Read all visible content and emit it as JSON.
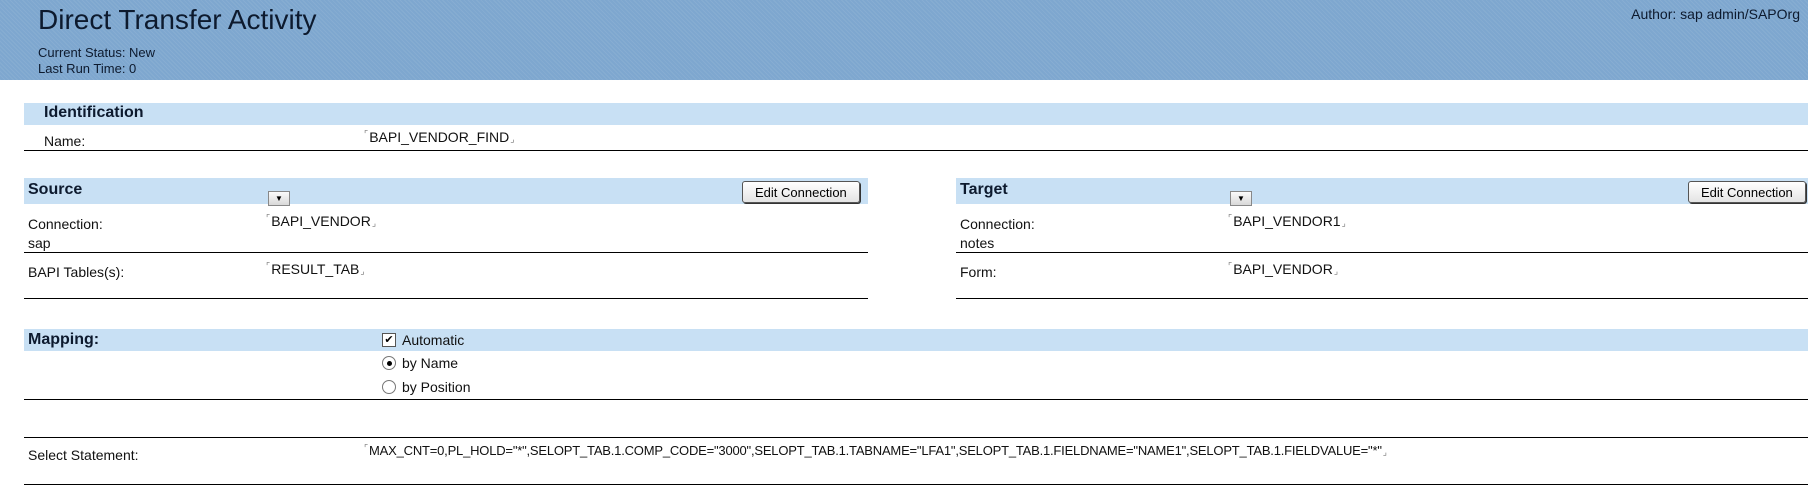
{
  "header": {
    "title": "Direct Transfer Activity",
    "current_status": "Current Status: New",
    "last_run": "Last Run Time:  0",
    "author": "Author: sap admin/SAPOrg"
  },
  "identification": {
    "heading": "Identification",
    "name_label": "Name:",
    "name_value": "BAPI_VENDOR_FIND"
  },
  "source": {
    "heading": "Source",
    "edit_button": "Edit Connection",
    "connection_label": "Connection:",
    "connection_type": "sap",
    "connection_value": "BAPI_VENDOR",
    "tables_label": "BAPI Tables(s):",
    "tables_value": "RESULT_TAB"
  },
  "target": {
    "heading": "Target",
    "edit_button": "Edit Connection",
    "connection_label": "Connection:",
    "connection_type": "notes",
    "connection_value": "BAPI_VENDOR1",
    "form_label": "Form:",
    "form_value": "BAPI_VENDOR"
  },
  "mapping": {
    "heading": "Mapping:",
    "automatic_label": "Automatic",
    "automatic_checked": true,
    "by_name_label": "by Name",
    "by_position_label": "by Position",
    "selected": "by Name"
  },
  "select_statement": {
    "label": "Select Statement:",
    "value": "MAX_CNT=0,PL_HOLD=\"*\",SELOPT_TAB.1.COMP_CODE=\"3000\",SELOPT_TAB.1.TABNAME=\"LFA1\",SELOPT_TAB.1.FIELDNAME=\"NAME1\",SELOPT_TAB.1.FIELDVALUE=\"*\""
  },
  "glyphs": {
    "field_open": "⌜",
    "field_close": "⌟",
    "dropdown_arrow": "▼",
    "checkmark": "✔"
  },
  "colors": {
    "header_bg": "#7ea7cf",
    "section_band": "#c8e0f4",
    "title_text": "#0d1a2e"
  }
}
